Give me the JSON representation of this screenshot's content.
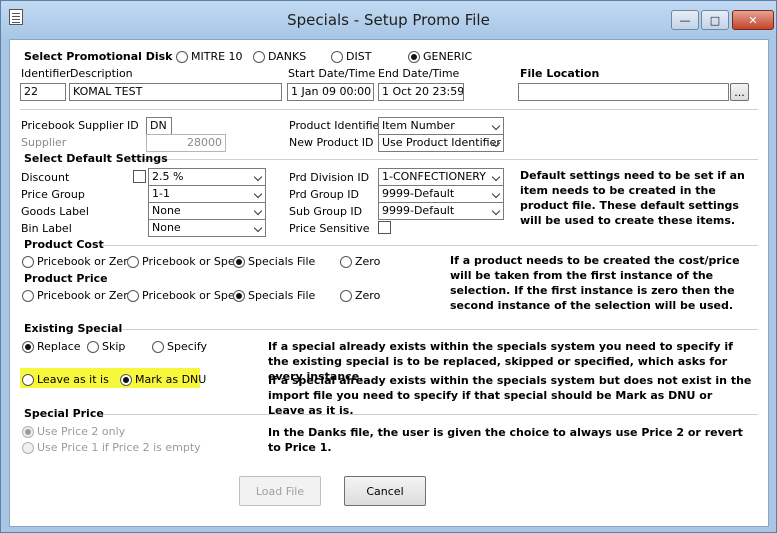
{
  "window": {
    "title": "Specials - Setup Promo File"
  },
  "disk": {
    "label": "Select Promotional Disk",
    "options": [
      "MITRE 10",
      "DANKS",
      "DIST",
      "GENERIC"
    ],
    "selected": "GENERIC"
  },
  "header": {
    "identifier_label": "Identifier",
    "description_label": "Description",
    "start_label": "Start Date/Time",
    "end_label": "End Date/Time",
    "file_location_label": "File Location",
    "identifier": "22",
    "description": "KOMAL TEST",
    "start": "1 Jan 09 00:00",
    "end": "1 Oct 20 23:59",
    "file_location": "",
    "browse_label": "..."
  },
  "pricebook": {
    "supplier_id_label": "Pricebook Supplier ID",
    "supplier_id": "DN",
    "supplier_label": "Supplier",
    "supplier": "28000",
    "product_identifier_label": "Product Identifier",
    "product_identifier": "Item Number",
    "new_product_id_label": "New Product ID",
    "new_product_id": "Use Product Identifier"
  },
  "defaults": {
    "section_label": "Select Default Settings",
    "discount_label": "Discount",
    "discount": "2.5 %",
    "price_group_label": "Price Group",
    "price_group": "1-1",
    "goods_label_label": "Goods Label",
    "goods_label": "None",
    "bin_label_label": "Bin Label",
    "bin_label": "None",
    "prd_division_label": "Prd Division ID",
    "prd_division": "1-CONFECTIONERY",
    "prd_group_label": "Prd Group ID",
    "prd_group": "9999-Default",
    "sub_group_label": "Sub Group ID",
    "sub_group": "9999-Default",
    "price_sensitive_label": "Price Sensitive",
    "help": "Default settings need to be set if an item needs to be created in the product file. These default settings will be used to create these items."
  },
  "product_cost": {
    "label": "Product Cost",
    "options": [
      "Pricebook or Zero",
      "Pricebook or Special",
      "Specials File",
      "Zero"
    ],
    "selected": "Specials File"
  },
  "product_price": {
    "label": "Product Price",
    "options": [
      "Pricebook or Zero",
      "Pricebook or Special",
      "Specials File",
      "Zero"
    ],
    "selected": "Specials File",
    "help": "If a product needs to be created the cost/price will be taken from the first instance of the selection. If the first instance is zero then the second instance of the selection will be used."
  },
  "existing_special": {
    "label": "Existing Special",
    "options": [
      "Replace",
      "Skip",
      "Specify"
    ],
    "selected": "Replace",
    "help": "If a special already exists within the specials system you need to specify if the existing special is to be replaced, skipped or specified, which asks for every instance.",
    "dnu_options": [
      "Leave as it is",
      "Mark as DNU"
    ],
    "dnu_selected": "Mark as DNU",
    "dnu_help": "If a special already exists within the specials system but does not exist in the import file you need to specify if that special should be Mark as DNU or Leave as it is.",
    "highlight_color": "#f7f73b"
  },
  "special_price": {
    "label": "Special Price",
    "options": [
      "Use Price 2 only",
      "Use Price 1 if Price 2 is empty"
    ],
    "selected": "Use Price 2 only",
    "help": "In the Danks file, the user is given the choice to always use Price 2 or revert to Price 1."
  },
  "buttons": {
    "load": "Load File",
    "cancel": "Cancel"
  }
}
